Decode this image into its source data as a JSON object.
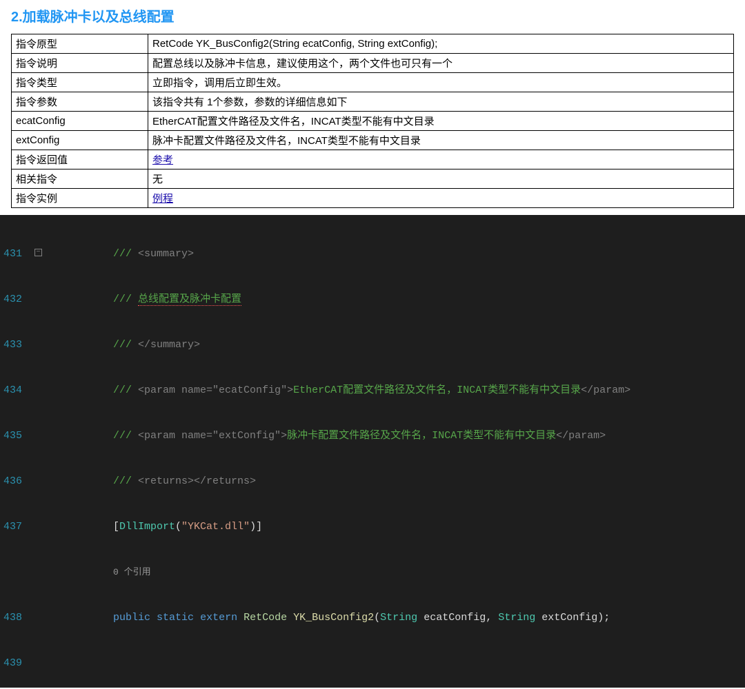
{
  "heading": "2.加载脉冲卡以及总线配置",
  "table": {
    "rows": [
      {
        "key": "指令原型",
        "val": "RetCode YK_BusConfig2(String ecatConfig, String extConfig);",
        "link": false
      },
      {
        "key": "指令说明",
        "val": "配置总线以及脉冲卡信息，建议使用这个，两个文件也可只有一个",
        "link": false
      },
      {
        "key": "指令类型",
        "val": "立即指令，调用后立即生效。",
        "link": false
      },
      {
        "key": "指令参数",
        "val": "该指令共有 1个参数，参数的详细信息如下",
        "link": false
      },
      {
        "key": "ecatConfig",
        "val": "EtherCAT配置文件路径及文件名，INCAT类型不能有中文目录",
        "link": false
      },
      {
        "key": "extConfig",
        "val": "脉冲卡配置文件路径及文件名，INCAT类型不能有中文目录",
        "link": false
      },
      {
        "key": "指令返回值",
        "val": "参考",
        "link": true
      },
      {
        "key": "相关指令",
        "val": "无",
        "link": false
      },
      {
        "key": "指令实例",
        "val": "例程",
        "link": true
      }
    ]
  },
  "code": {
    "lines": {
      "l431": {
        "no": "431",
        "a": "/// ",
        "b": "<summary>"
      },
      "l432": {
        "no": "432",
        "a": "/// ",
        "b": "总线配置及脉冲卡配置"
      },
      "l433": {
        "no": "433",
        "a": "/// ",
        "b": "</summary>"
      },
      "l434": {
        "no": "434",
        "a": "/// ",
        "b": "<param name=",
        "c": "\"ecatConfig\"",
        "d": ">",
        "e": "EtherCAT配置文件路径及文件名，INCAT类型不能有中文目录",
        "f": "</param>"
      },
      "l435": {
        "no": "435",
        "a": "/// ",
        "b": "<param name=",
        "c": "\"extConfig\"",
        "d": ">",
        "e": "脉冲卡配置文件路径及文件名，INCAT类型不能有中文目录",
        "f": "</param>"
      },
      "l436": {
        "no": "436",
        "a": "/// ",
        "b": "<returns></returns>"
      },
      "l437": {
        "no": "437",
        "a": "[",
        "b": "DllImport",
        "c": "(",
        "d": "\"YKCat.dll\"",
        "e": ")]"
      },
      "lref": {
        "no": "",
        "a": "0 个引用"
      },
      "l438": {
        "no": "438",
        "a": "public",
        "b": " ",
        "c": "static",
        "d": " ",
        "e": "extern",
        "f": " ",
        "g": "RetCode",
        "h": " ",
        "i": "YK_BusConfig2",
        "j": "(",
        "k": "String",
        "l": " ecatConfig, ",
        "m": "String",
        "n": " extConfig);"
      },
      "l439": {
        "no": "439"
      }
    }
  }
}
